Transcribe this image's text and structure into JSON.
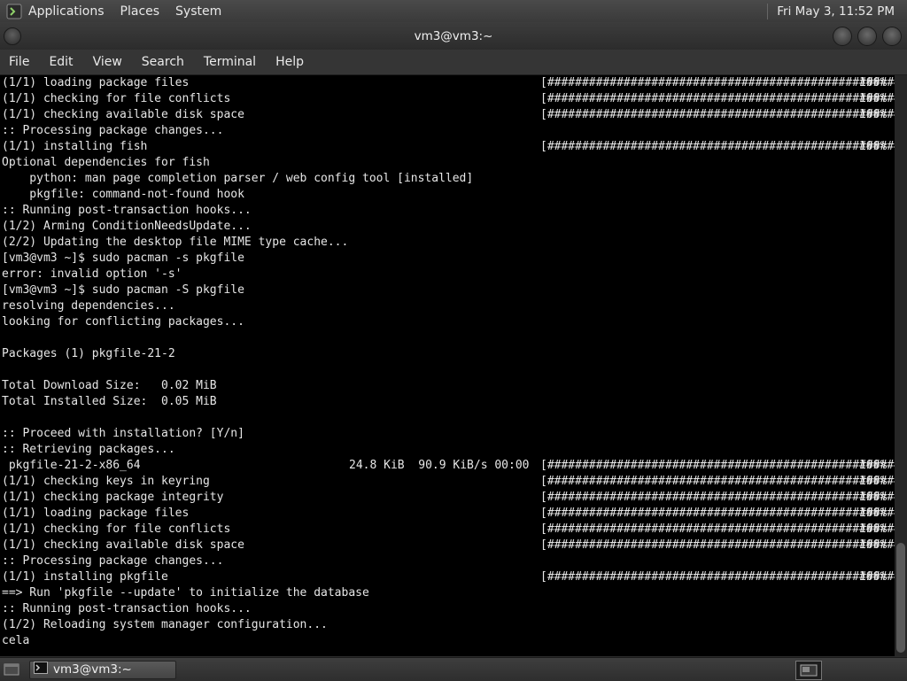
{
  "top_panel": {
    "menus": [
      "Applications",
      "Places",
      "System"
    ],
    "clock": "Fri May  3, 11:52 PM"
  },
  "window": {
    "title": "vm3@vm3:~"
  },
  "menubar": {
    "items": [
      "File",
      "Edit",
      "View",
      "Search",
      "Terminal",
      "Help"
    ]
  },
  "terminal": {
    "lines": [
      {
        "text": "(1/1) loading package files",
        "bar": "[######################################################]",
        "pct": "100%"
      },
      {
        "text": "(1/1) checking for file conflicts",
        "bar": "[######################################################]",
        "pct": "100%"
      },
      {
        "text": "(1/1) checking available disk space",
        "bar": "[######################################################]",
        "pct": "100%"
      },
      {
        "text": ":: Processing package changes..."
      },
      {
        "text": "(1/1) installing fish",
        "bar": "[######################################################]",
        "pct": "100%"
      },
      {
        "text": "Optional dependencies for fish"
      },
      {
        "text": "    python: man page completion parser / web config tool [installed]"
      },
      {
        "text": "    pkgfile: command-not-found hook"
      },
      {
        "text": ":: Running post-transaction hooks..."
      },
      {
        "text": "(1/2) Arming ConditionNeedsUpdate..."
      },
      {
        "text": "(2/2) Updating the desktop file MIME type cache..."
      },
      {
        "text": "[vm3@vm3 ~]$ sudo pacman -s pkgfile"
      },
      {
        "text": "error: invalid option '-s'"
      },
      {
        "text": "[vm3@vm3 ~]$ sudo pacman -S pkgfile"
      },
      {
        "text": "resolving dependencies..."
      },
      {
        "text": "looking for conflicting packages..."
      },
      {
        "text": ""
      },
      {
        "text": "Packages (1) pkgfile-21-2"
      },
      {
        "text": ""
      },
      {
        "text": "Total Download Size:   0.02 MiB"
      },
      {
        "text": "Total Installed Size:  0.05 MiB"
      },
      {
        "text": ""
      },
      {
        "text": ":: Proceed with installation? [Y/n]"
      },
      {
        "text": ":: Retrieving packages..."
      },
      {
        "text": " pkgfile-21-2-x86_64",
        "dl": "24.8 KiB  90.9 KiB/s 00:00",
        "bar": "[######################################################]",
        "pct": "100%"
      },
      {
        "text": "(1/1) checking keys in keyring",
        "bar": "[######################################################]",
        "pct": "100%"
      },
      {
        "text": "(1/1) checking package integrity",
        "bar": "[######################################################]",
        "pct": "100%"
      },
      {
        "text": "(1/1) loading package files",
        "bar": "[######################################################]",
        "pct": "100%"
      },
      {
        "text": "(1/1) checking for file conflicts",
        "bar": "[######################################################]",
        "pct": "100%"
      },
      {
        "text": "(1/1) checking available disk space",
        "bar": "[######################################################]",
        "pct": "100%"
      },
      {
        "text": ":: Processing package changes..."
      },
      {
        "text": "(1/1) installing pkgfile",
        "bar": "[######################################################]",
        "pct": "100%"
      },
      {
        "text": "==> Run 'pkgfile --update' to initialize the database"
      },
      {
        "text": ":: Running post-transaction hooks..."
      },
      {
        "text": "(1/2) Reloading system manager configuration..."
      },
      {
        "text": "cela"
      }
    ]
  },
  "taskbar": {
    "task_label": "vm3@vm3:~"
  },
  "icons": {
    "applications": "terminal-app-icon",
    "window_menu": "window-menu-icon",
    "controls": [
      "minimize-icon",
      "maximize-icon",
      "close-icon"
    ],
    "show_desktop": "show-desktop-icon",
    "task": "terminal-icon",
    "workspace": "workspace-icon"
  },
  "colors": {
    "terminal_bg": "#000000",
    "terminal_fg": "#e6e6e6",
    "panel_bg": "#3a3a3a"
  }
}
